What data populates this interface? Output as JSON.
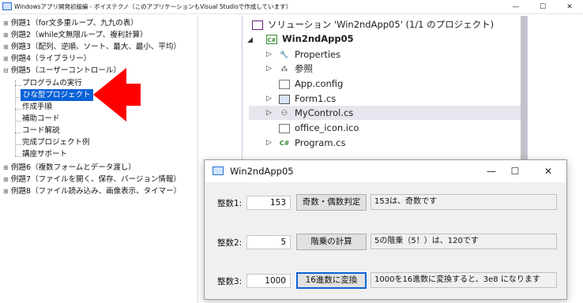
{
  "window": {
    "title": "Windowsアプリ開発初級編 - ボイステクノ（このアプリケーションもVisual Studioで作成しています）",
    "minimize": "—",
    "maximize": "☐",
    "close": "✕"
  },
  "tree": {
    "expand_glyph": "⊞",
    "items": [
      {
        "label": "例題1（for文多重ループ、九九の表）"
      },
      {
        "label": "例題2（while文無限ループ、複利計算）"
      },
      {
        "label": "例題3（配列、逆順、ソート、最大、最小、平均）"
      },
      {
        "label": "例題4（ライブラリー）"
      },
      {
        "label": "例題5（ユーザーコントロール）"
      },
      {
        "label": "プログラムの実行"
      },
      {
        "label": "ひな型プロジェクト"
      },
      {
        "label": "作成手順"
      },
      {
        "label": "補助コード"
      },
      {
        "label": "コード解説"
      },
      {
        "label": "完成プロジェクト例"
      },
      {
        "label": "講座サポート"
      },
      {
        "label": "例題6（複数フォームとデータ渡し）"
      },
      {
        "label": "例題7（ファイルを開く、保存、バージョン情報）"
      },
      {
        "label": "例題8（ファイル読み込み、画像表示、タイマー）"
      }
    ]
  },
  "solution": {
    "title": "ソリューション 'Win2ndApp05' (1/1 のプロジェクト)",
    "project": "Win2ndApp05",
    "items": [
      {
        "label": "Properties",
        "icon": "wrench-icon"
      },
      {
        "label": "参照",
        "icon": "references-icon"
      },
      {
        "label": "App.config",
        "icon": "config-icon"
      },
      {
        "label": "Form1.cs",
        "icon": "form-icon"
      },
      {
        "label": "MyControl.cs",
        "icon": "user-control-icon"
      },
      {
        "label": "office_icon.ico",
        "icon": "image-icon"
      },
      {
        "label": "Program.cs",
        "icon": "csharp-icon"
      }
    ],
    "csharp_badge": "C#",
    "project_badge": "C#"
  },
  "dialog": {
    "title": "Win2ndApp05",
    "minimize": "—",
    "maximize": "☐",
    "close": "✕",
    "rows": [
      {
        "label": "整数1:",
        "value": "153",
        "button": "奇数・偶数判定",
        "result": "153は、奇数です"
      },
      {
        "label": "整数2:",
        "value": "5",
        "button": "階乗の計算",
        "result": "5の階乗（5！）は、120です"
      },
      {
        "label": "整数3:",
        "value": "1000",
        "button": "16進数に変換",
        "result": "1000を16進数に変換すると、3e8 になります"
      }
    ]
  },
  "colors": {
    "selection": "#0a62d8",
    "arrow": "#ff0000",
    "vs_highlight": "#e6e6ee"
  }
}
